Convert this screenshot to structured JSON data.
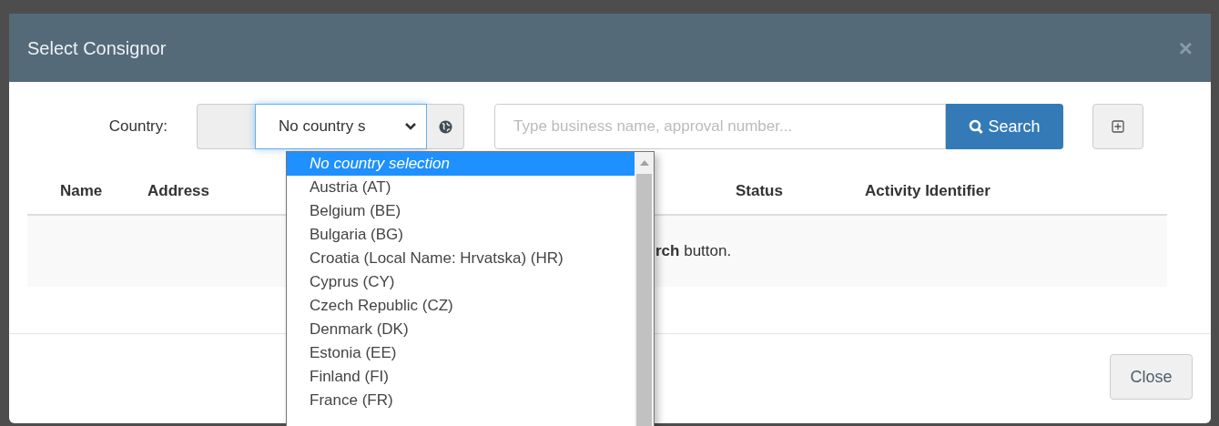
{
  "dialog": {
    "title": "Select Consignor",
    "close_symbol": "×"
  },
  "filter": {
    "country_label": "Country:",
    "country_value": "No country s",
    "search_placeholder": "Type business name, approval number...",
    "search_button": "Search"
  },
  "table": {
    "columns": [
      {
        "label": "Name"
      },
      {
        "label": "Address"
      },
      {
        "label": "Status"
      },
      {
        "label": "Activity Identifier"
      }
    ],
    "message": "**rch** button."
  },
  "country_options": [
    {
      "label": "No country selection",
      "selected": true
    },
    {
      "label": "Austria (AT)",
      "selected": false
    },
    {
      "label": "Belgium (BE)",
      "selected": false
    },
    {
      "label": "Bulgaria (BG)",
      "selected": false
    },
    {
      "label": "Croatia (Local Name: Hrvatska) (HR)",
      "selected": false
    },
    {
      "label": "Cyprus (CY)",
      "selected": false
    },
    {
      "label": "Czech Republic (CZ)",
      "selected": false
    },
    {
      "label": "Denmark (DK)",
      "selected": false
    },
    {
      "label": "Estonia (EE)",
      "selected": false
    },
    {
      "label": "Finland (FI)",
      "selected": false
    },
    {
      "label": "France (FR)",
      "selected": false
    }
  ],
  "footer": {
    "close_button": "Close"
  }
}
